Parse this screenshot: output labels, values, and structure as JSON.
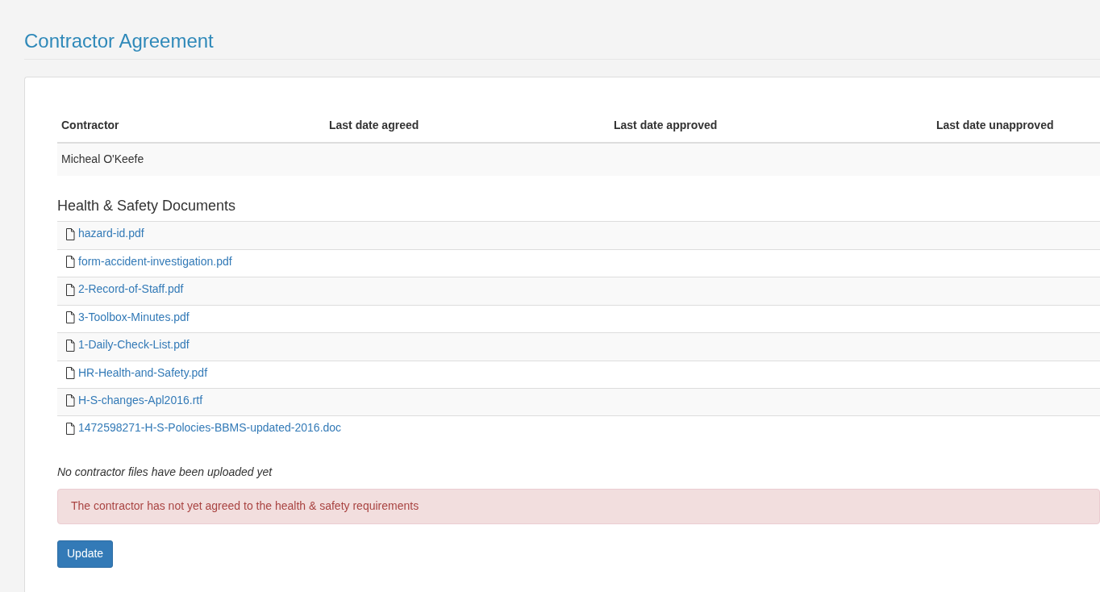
{
  "page_title": "Contractor Agreement",
  "table": {
    "columns": [
      "Contractor",
      "Last date agreed",
      "Last date approved",
      "Last date unapproved"
    ],
    "rows": [
      {
        "cells": [
          "Micheal O'Keefe"
        ]
      }
    ]
  },
  "documents": {
    "title": "Health & Safety Documents",
    "files": [
      "hazard-id.pdf",
      "form-accident-investigation.pdf",
      "2-Record-of-Staff.pdf",
      "3-Toolbox-Minutes.pdf",
      "1-Daily-Check-List.pdf",
      "HR-Health-and-Safety.pdf",
      "H-S-changes-Apl2016.rtf",
      "1472598271-H-S-Polocies-BBMS-updated-2016.doc"
    ]
  },
  "empty_note": "No contractor files have been uploaded yet",
  "alert": {
    "kind": "danger",
    "text": "The contractor has not yet agreed to the health & safety requirements"
  },
  "buttons": [
    {
      "label": "Update"
    }
  ]
}
